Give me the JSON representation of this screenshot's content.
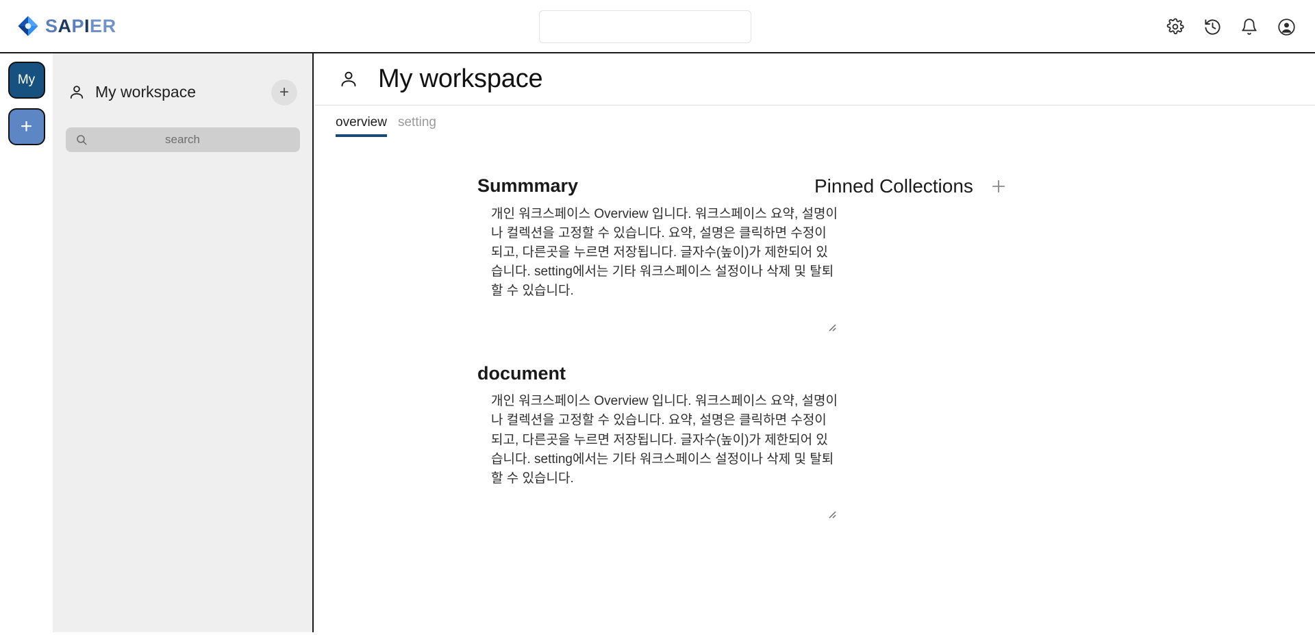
{
  "header": {
    "brand": {
      "logo_icon": "diamond-logo-icon",
      "name_parts": [
        "S",
        "A",
        "P",
        "I",
        "E",
        "R"
      ],
      "colors": {
        "light_blue": "#6f93c9",
        "dark_blue": "#1b3a5c",
        "mid_blue": "#5b7fb8"
      }
    },
    "search": {
      "value": "",
      "placeholder": ""
    },
    "actions": [
      {
        "name": "settings-icon",
        "label": "Settings"
      },
      {
        "name": "history-icon",
        "label": "History"
      },
      {
        "name": "notifications-icon",
        "label": "Notifications"
      },
      {
        "name": "account-icon",
        "label": "Account"
      }
    ]
  },
  "rail": {
    "buttons": [
      {
        "name": "workspace-my-button",
        "label": "My",
        "color": "#17517f"
      },
      {
        "name": "add-workspace-button",
        "label": "+",
        "color": "#5d86c4"
      }
    ]
  },
  "sidebar": {
    "workspace": {
      "icon": "person-icon",
      "name": "My workspace",
      "add_label": "+"
    },
    "search": {
      "value": "",
      "placeholder": "search",
      "icon": "search-icon"
    }
  },
  "main": {
    "page": {
      "icon": "person-icon",
      "title": "My workspace"
    },
    "tabs": [
      {
        "label": "overview",
        "active": true
      },
      {
        "label": "setting",
        "active": false
      }
    ],
    "sections": [
      {
        "title": "Summmary",
        "body": "개인 워크스페이스 Overview 입니다. 워크스페이스 요약, 설명이나 컬렉션을 고정할 수 있습니다. 요약, 설명은 클릭하면 수정이 되고, 다른곳을 누르면 저장됩니다. 글자수(높이)가 제한되어 있습니다. setting에서는 기타 워크스페이스 설정이나 삭제 및 탈퇴 할 수 있습니다."
      },
      {
        "title": "document",
        "body": "개인 워크스페이스 Overview 입니다. 워크스페이스 요약, 설명이나 컬렉션을 고정할 수 있습니다. 요약, 설명은 클릭하면 수정이 되고, 다른곳을 누르면 저장됩니다. 글자수(높이)가 제한되어 있습니다. setting에서는 기타 워크스페이스 설정이나 삭제 및 탈퇴 할 수 있습니다."
      }
    ],
    "pinned": {
      "title": "Pinned Collections",
      "add_label": "+",
      "items": []
    }
  },
  "colors": {
    "accent": "#1b4a77",
    "sidebar_bg": "#efefef",
    "rail_primary": "#17517f",
    "rail_add": "#5d86c4"
  }
}
